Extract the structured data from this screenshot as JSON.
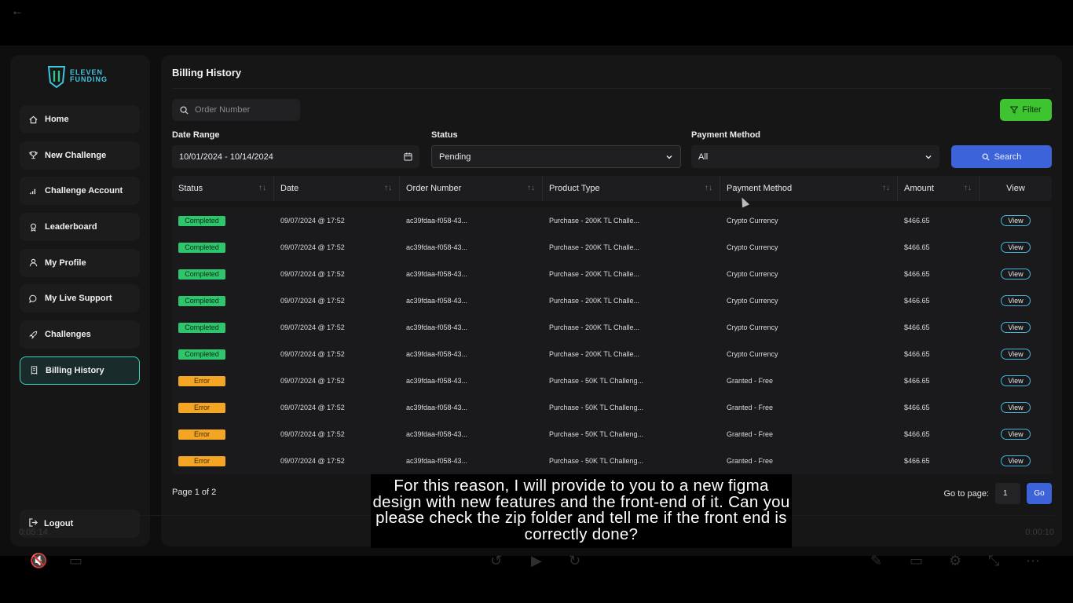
{
  "brand": {
    "line1": "ELEVEN",
    "line2": "FUNDING"
  },
  "sidebar": {
    "items": [
      {
        "label": "Home",
        "icon": "home-icon"
      },
      {
        "label": "New Challenge",
        "icon": "trophy-icon"
      },
      {
        "label": "Challenge Account",
        "icon": "bar-chart-icon"
      },
      {
        "label": "Leaderboard",
        "icon": "medal-icon"
      },
      {
        "label": "My Profile",
        "icon": "user-icon"
      },
      {
        "label": "My Live Support",
        "icon": "chat-icon"
      },
      {
        "label": "Challenges",
        "icon": "rocket-icon"
      },
      {
        "label": "Billing History",
        "icon": "receipt-icon",
        "active": true
      }
    ],
    "logout": "Logout"
  },
  "main": {
    "title": "Billing History",
    "search_placeholder": "Order Number",
    "filter_label": "Filter",
    "date_range": {
      "label": "Date Range",
      "value": "10/01/2024 - 10/14/2024"
    },
    "status": {
      "label": "Status",
      "value": "Pending"
    },
    "payment_method": {
      "label": "Payment Method",
      "value": "All"
    },
    "search_label": "Search",
    "columns": [
      "Status",
      "Date",
      "Order Number",
      "Product Type",
      "Payment Method",
      "Amount",
      "View"
    ],
    "rows": [
      {
        "status": "Completed",
        "date": "09/07/2024 @ 17:52",
        "order": "ac39fdaa-f058-43...",
        "product": "Purchase - 200K TL Challe...",
        "method": "Crypto Currency",
        "amount": "$466.65",
        "view": "View"
      },
      {
        "status": "Completed",
        "date": "09/07/2024 @ 17:52",
        "order": "ac39fdaa-f058-43...",
        "product": "Purchase - 200K TL Challe...",
        "method": "Crypto Currency",
        "amount": "$466.65",
        "view": "View"
      },
      {
        "status": "Completed",
        "date": "09/07/2024 @ 17:52",
        "order": "ac39fdaa-f058-43...",
        "product": "Purchase - 200K TL Challe...",
        "method": "Crypto Currency",
        "amount": "$466.65",
        "view": "View"
      },
      {
        "status": "Completed",
        "date": "09/07/2024 @ 17:52",
        "order": "ac39fdaa-f058-43...",
        "product": "Purchase - 200K TL Challe...",
        "method": "Crypto Currency",
        "amount": "$466.65",
        "view": "View"
      },
      {
        "status": "Completed",
        "date": "09/07/2024 @ 17:52",
        "order": "ac39fdaa-f058-43...",
        "product": "Purchase - 200K TL Challe...",
        "method": "Crypto Currency",
        "amount": "$466.65",
        "view": "View"
      },
      {
        "status": "Completed",
        "date": "09/07/2024 @ 17:52",
        "order": "ac39fdaa-f058-43...",
        "product": "Purchase - 200K TL Challe...",
        "method": "Crypto Currency",
        "amount": "$466.65",
        "view": "View"
      },
      {
        "status": "Error",
        "date": "09/07/2024 @ 17:52",
        "order": "ac39fdaa-f058-43...",
        "product": "Purchase - 50K TL Challeng...",
        "method": "Granted - Free",
        "amount": "$466.65",
        "view": "View"
      },
      {
        "status": "Error",
        "date": "09/07/2024 @ 17:52",
        "order": "ac39fdaa-f058-43...",
        "product": "Purchase - 50K TL Challeng...",
        "method": "Granted - Free",
        "amount": "$466.65",
        "view": "View"
      },
      {
        "status": "Error",
        "date": "09/07/2024 @ 17:52",
        "order": "ac39fdaa-f058-43...",
        "product": "Purchase - 50K TL Challeng...",
        "method": "Granted - Free",
        "amount": "$466.65",
        "view": "View"
      },
      {
        "status": "Error",
        "date": "09/07/2024 @ 17:52",
        "order": "ac39fdaa-f058-43...",
        "product": "Purchase - 50K TL Challeng...",
        "method": "Granted - Free",
        "amount": "$466.65",
        "view": "View"
      }
    ],
    "page_info": "Page 1 of 2",
    "goto_label": "Go to page:",
    "goto_value": "1",
    "go_label": "Go"
  },
  "video": {
    "time_elapsed": "0:05:14",
    "time_remaining": "0:00:10",
    "caption": "For this reason, I will provide to you to a new figma design with new features and the front-end of it. Can you please check the zip folder and tell me if the front end is correctly done?"
  },
  "colors": {
    "accent_green": "#3fc431",
    "accent_blue": "#3d63db",
    "completed": "#2ec56d",
    "error": "#f5a524",
    "active_border": "#3fd0b5"
  }
}
